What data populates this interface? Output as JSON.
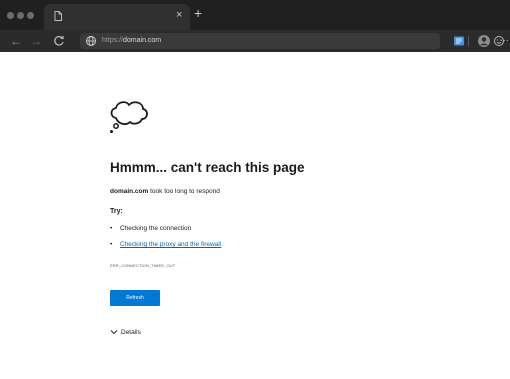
{
  "browser": {
    "tab": {
      "icon": "page-icon",
      "close_label": "×"
    },
    "new_tab_label": "+",
    "address": {
      "scheme": "https://",
      "host": "domain.com"
    },
    "toolbar_icons": [
      "back-icon",
      "forward-icon",
      "reload-icon",
      "reading-view-icon",
      "profile-icon",
      "smiley-icon",
      "more-icon"
    ],
    "more_label": "···"
  },
  "error_page": {
    "icon": "thought-cloud-icon",
    "title": "Hmmm... can't reach this page",
    "description_domain": "domain.com",
    "description_rest": " took too long to respond",
    "try_label": "Try:",
    "suggestions": [
      "Checking the connection",
      "Checking the proxy and the firewall"
    ],
    "error_code": "ERR_CONNECTION_TIMED_OUT",
    "refresh_label": "Refresh",
    "details_label": "Details"
  },
  "colors": {
    "titlebar": "#202020",
    "toolbar": "#2b2b2b",
    "address_bar": "#3a3a3a",
    "accent": "#0078d4",
    "link": "#0067b8",
    "text": "#1b1b1b"
  }
}
